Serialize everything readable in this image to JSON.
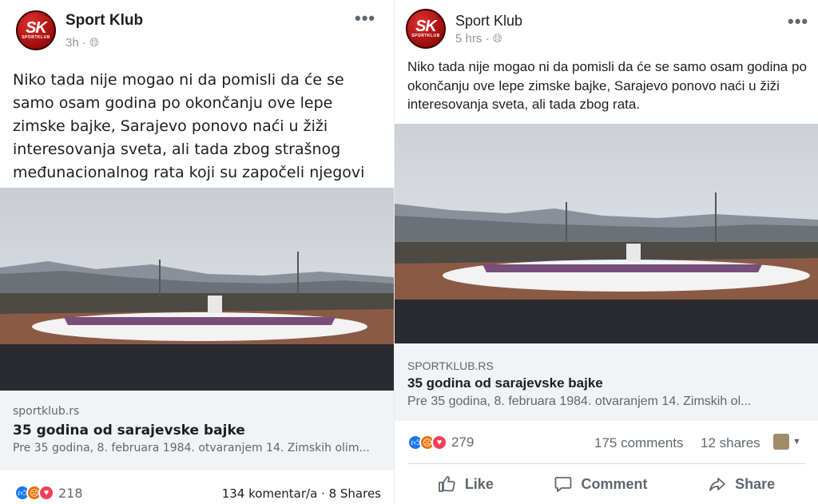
{
  "left": {
    "page_name": "Sport Klub",
    "time": "3h ·",
    "avatar": {
      "big": "SK",
      "small": "SPORTKLUB"
    },
    "text": "Niko tada nije mogao ni da pomisli da će se samo osam godina po okončanju ove lepe zimske bajke, Sarajevo ponovo naći u žiži interesovanja sveta, ali tada zbog strašnog međunacionalnog rata koji su započeli njegovi stanovnici.",
    "link": {
      "domain": "sportklub.rs",
      "title": "35 godina od sarajevske bajke",
      "desc": "Pre 35 godina, 8. februara 1984. otvaranjem 14. Zimskih olim..."
    },
    "reactions_count": "218",
    "stats": "134 komentar/a · 8 Shares"
  },
  "right": {
    "page_name": "Sport Klub",
    "time": "5 hrs ·",
    "avatar": {
      "big": "SK",
      "small": "SPORTKLUB"
    },
    "text": "Niko tada nije mogao ni da pomisli da će se samo osam godina po okončanju ove lepe zimske bajke, Sarajevo ponovo naći u žiži interesovanja sveta, ali tada zbog rata.",
    "link": {
      "domain": "SPORTKLUB.RS",
      "title": "35 godina od sarajevske bajke",
      "desc": "Pre 35 godina, 8. februara 1984. otvaranjem 14. Zimskih ol..."
    },
    "reactions_count": "279",
    "comments": "175 comments",
    "shares": "12 shares",
    "actions": {
      "like": "Like",
      "comment": "Comment",
      "share": "Share"
    }
  },
  "icons": [
    "globe-icon",
    "more-icon",
    "like-reaction-icon",
    "angry-reaction-icon",
    "love-reaction-icon",
    "thumb-up-icon",
    "comment-icon",
    "share-icon",
    "chevron-down-icon"
  ],
  "colors": {
    "facebook_blue": "#1877f2",
    "angry": "#e9710f",
    "love": "#f33e58",
    "link_bg": "#f2f3f5"
  }
}
